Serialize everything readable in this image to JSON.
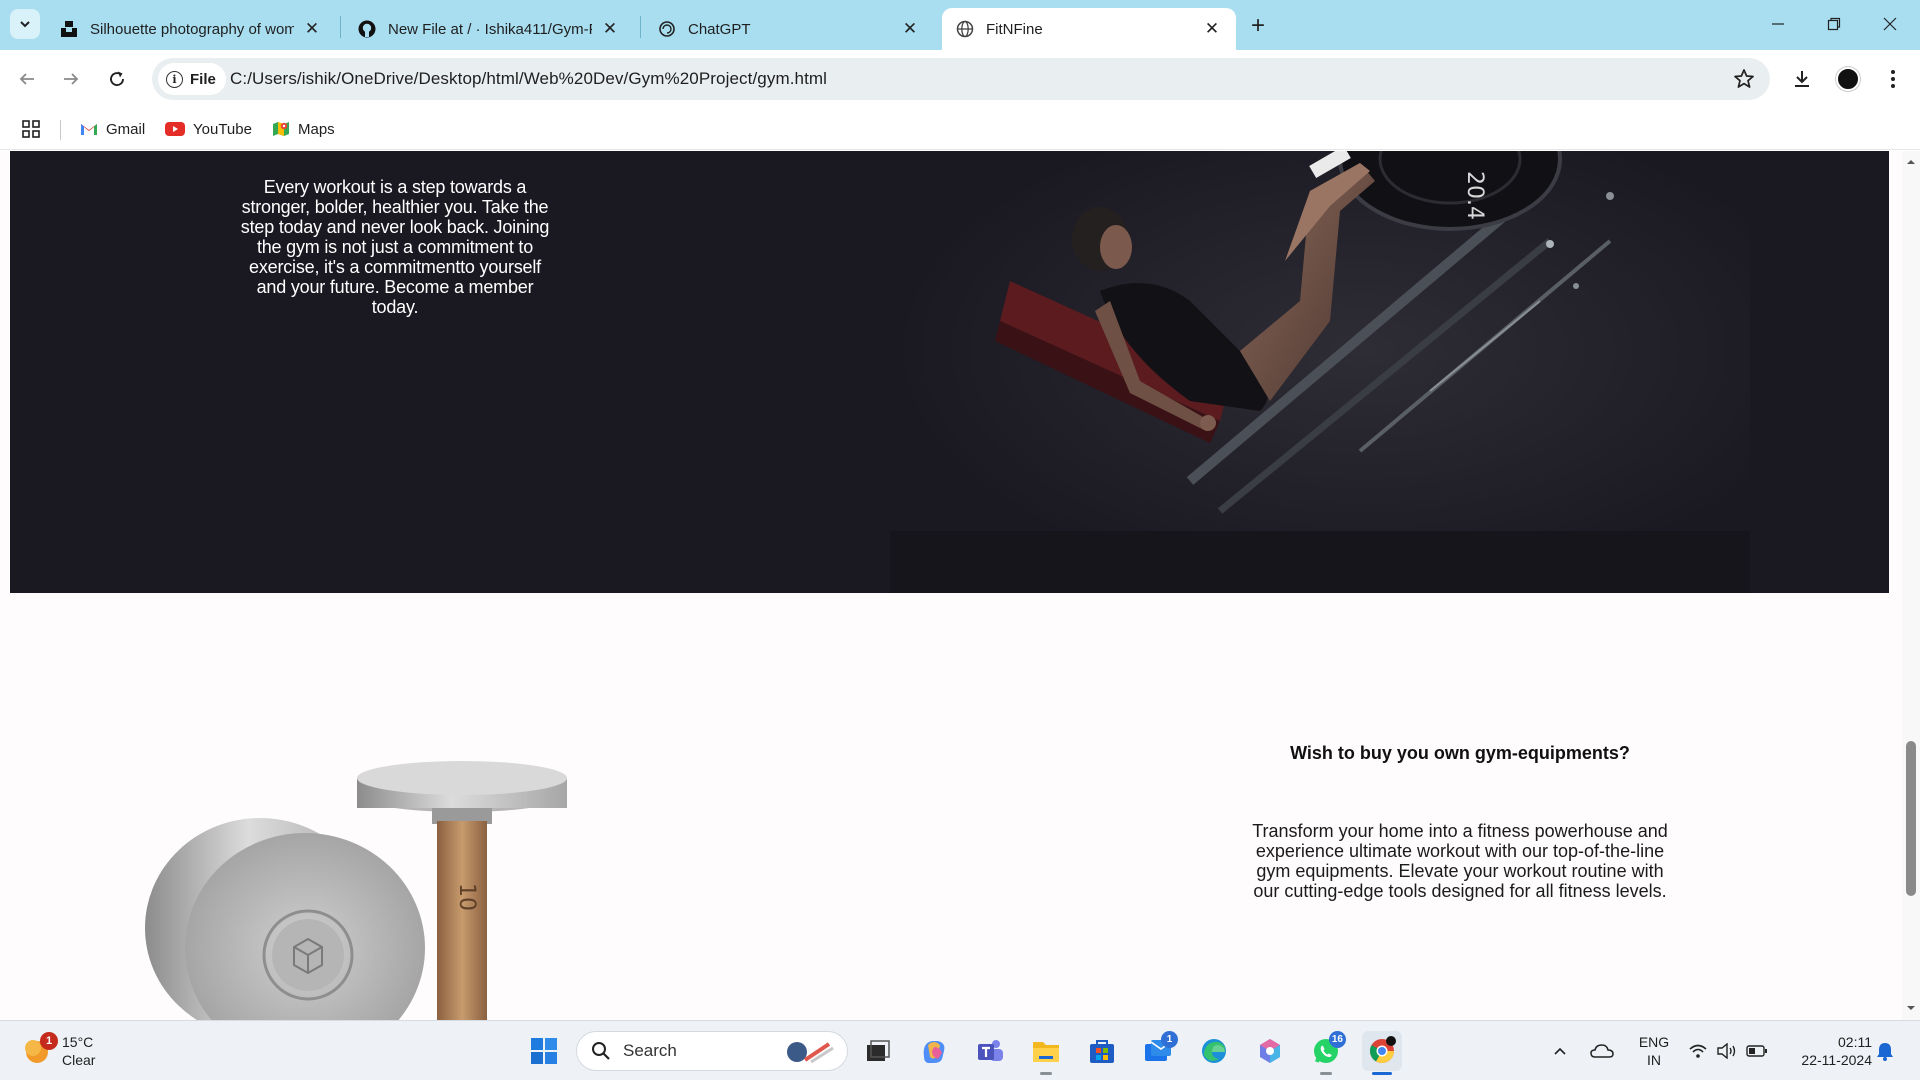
{
  "browser": {
    "tabs": [
      {
        "title": "Silhouette photography of wom",
        "favicon": "unsplash-icon",
        "active": false
      },
      {
        "title": "New File at / · Ishika411/Gym-P",
        "favicon": "github-icon",
        "active": false
      },
      {
        "title": "ChatGPT",
        "favicon": "chatgpt-icon",
        "active": false
      },
      {
        "title": "FitNFine",
        "favicon": "globe-icon",
        "active": true
      }
    ],
    "tab_close_glyph": "✕",
    "new_tab_glyph": "+",
    "file_chip_label": "File",
    "url": "C:/Users/ishik/OneDrive/Desktop/html/Web%20Dev/Gym%20Project/gym.html",
    "bookmarks": [
      {
        "label": "Gmail",
        "icon": "gmail-icon"
      },
      {
        "label": "YouTube",
        "icon": "youtube-icon"
      },
      {
        "label": "Maps",
        "icon": "maps-icon"
      }
    ]
  },
  "page": {
    "hero_text": "Every workout is a step towards a stronger, bolder, healthier you. Take the step today and never look back. Joining the gym is not just a commitment to exercise, it's a commitmentto yourself and your future. Become a member today.",
    "plate_number": "20.4",
    "equipment": {
      "title": "Wish to buy you own gym-equipments?",
      "text": "Transform your home into a fitness powerhouse and experience ultimate workout with our top-of-the-line gym equipments. Elevate your workout routine with our cutting-edge tools designed for all fitness levels.",
      "dumbbell_number": "10"
    }
  },
  "taskbar": {
    "weather": {
      "temp": "15°C",
      "condition": "Clear",
      "badge": "1"
    },
    "search_placeholder": "Search",
    "pinned": [
      {
        "name": "task-view-icon"
      },
      {
        "name": "copilot-icon"
      },
      {
        "name": "teams-icon"
      },
      {
        "name": "file-explorer-icon"
      },
      {
        "name": "microsoft-store-icon"
      },
      {
        "name": "mail-icon",
        "badge": "1"
      },
      {
        "name": "edge-icon"
      },
      {
        "name": "photos-icon"
      },
      {
        "name": "whatsapp-icon",
        "badge": "16"
      },
      {
        "name": "chrome-icon"
      }
    ],
    "language": {
      "line1": "ENG",
      "line2": "IN"
    },
    "clock": {
      "time": "02:11",
      "date": "22-11-2024"
    }
  },
  "colors": {
    "tabstrip": "#a8def0",
    "hero_bg": "#1a1821",
    "accent_blue": "#1a66d2"
  }
}
